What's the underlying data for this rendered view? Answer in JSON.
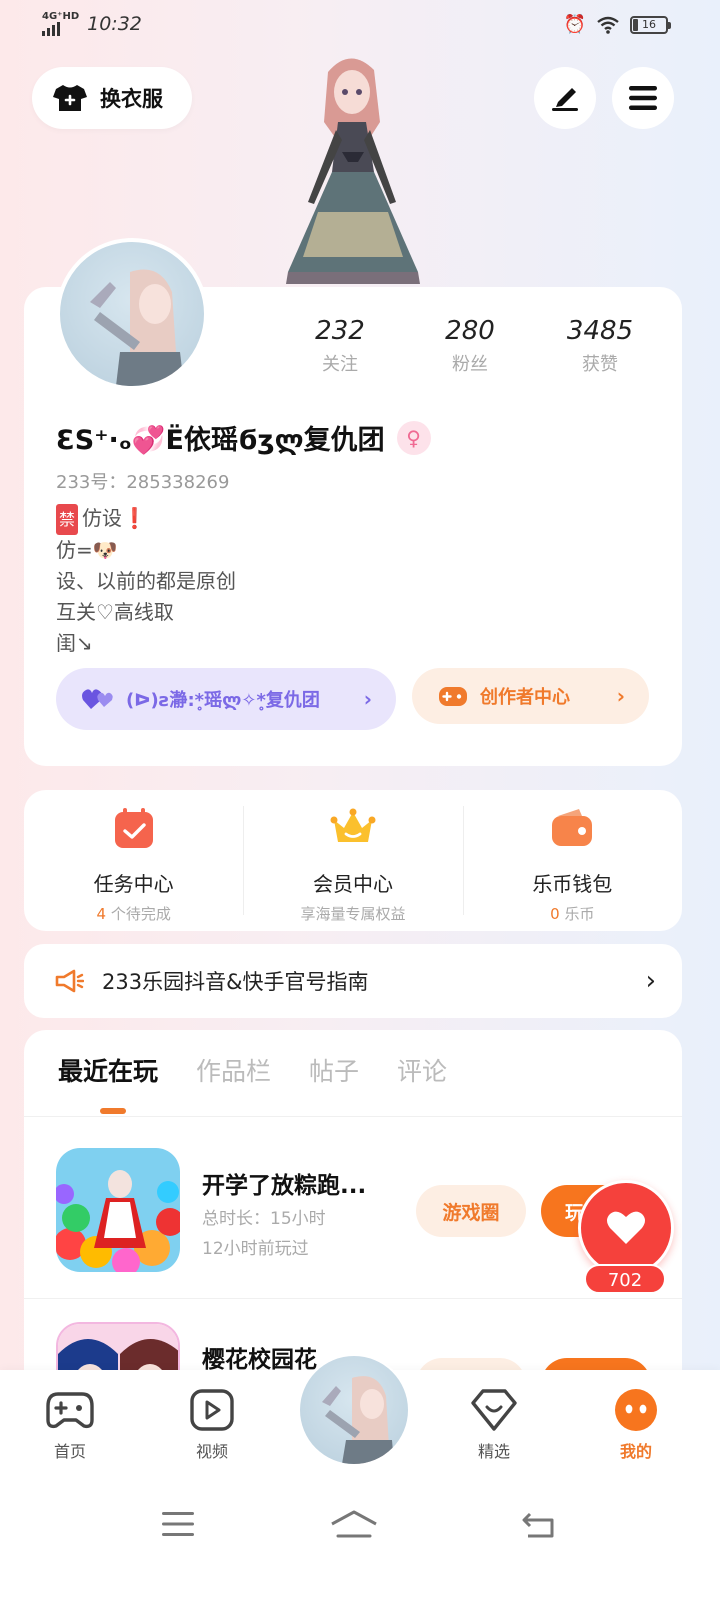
{
  "status_bar": {
    "network": "4G⁺HD",
    "time": "10:32",
    "battery": "16"
  },
  "top_actions": {
    "dress_label": "换衣服"
  },
  "profile": {
    "stats": [
      {
        "value": "232",
        "label": "关注"
      },
      {
        "value": "280",
        "label": "粉丝"
      },
      {
        "value": "3485",
        "label": "获赞"
      }
    ],
    "nickname": "ƐЅ⁺·ₒ💞Ë依瑶ϭʒლ复仇团",
    "gender_symbol": "♀",
    "uid": "233号：285338269",
    "bio": {
      "line1_chip": "禁",
      "line1": "仿设❗",
      "line2": "仿=🐶",
      "line3": "设、以前的都是原创",
      "line4": "互关♡高线取",
      "line5": "闺↘"
    },
    "team_pill": "(ᐅ)ƨ瀞:*̥瑶ლ✧*̥复仇团",
    "creator_pill": "创作者中心"
  },
  "services": [
    {
      "title": "任务中心",
      "sub_num": "4",
      "sub_text": "个待完成"
    },
    {
      "title": "会员中心",
      "sub_num": "",
      "sub_text": "享海量专属权益"
    },
    {
      "title": "乐币钱包",
      "sub_num": "0",
      "sub_text": "乐币"
    }
  ],
  "notice": {
    "text": "233乐园抖音&快手官号指南"
  },
  "tabs": [
    "最近在玩",
    "作品栏",
    "帖子",
    "评论"
  ],
  "games": [
    {
      "title": "开学了放粽跑...",
      "total_time": "总时长：15小时",
      "last_played": "12小时前玩过",
      "circle_btn": "游戏圈",
      "play_btn": "玩"
    },
    {
      "title": "樱花校园花",
      "total_time": "",
      "last_played": "",
      "circle_btn": "",
      "play_btn": ""
    }
  ],
  "like": {
    "count": "702"
  },
  "bottom_nav": [
    {
      "label": "首页",
      "icon": "gamepad-icon"
    },
    {
      "label": "视频",
      "icon": "play-icon"
    },
    {
      "label": "精选",
      "icon": "heart-badge-icon"
    },
    {
      "label": "我的",
      "icon": "face-icon"
    }
  ],
  "colors": {
    "accent": "#f07a2c",
    "like_red": "#f5413c",
    "team_purple": "#7b69e6"
  }
}
